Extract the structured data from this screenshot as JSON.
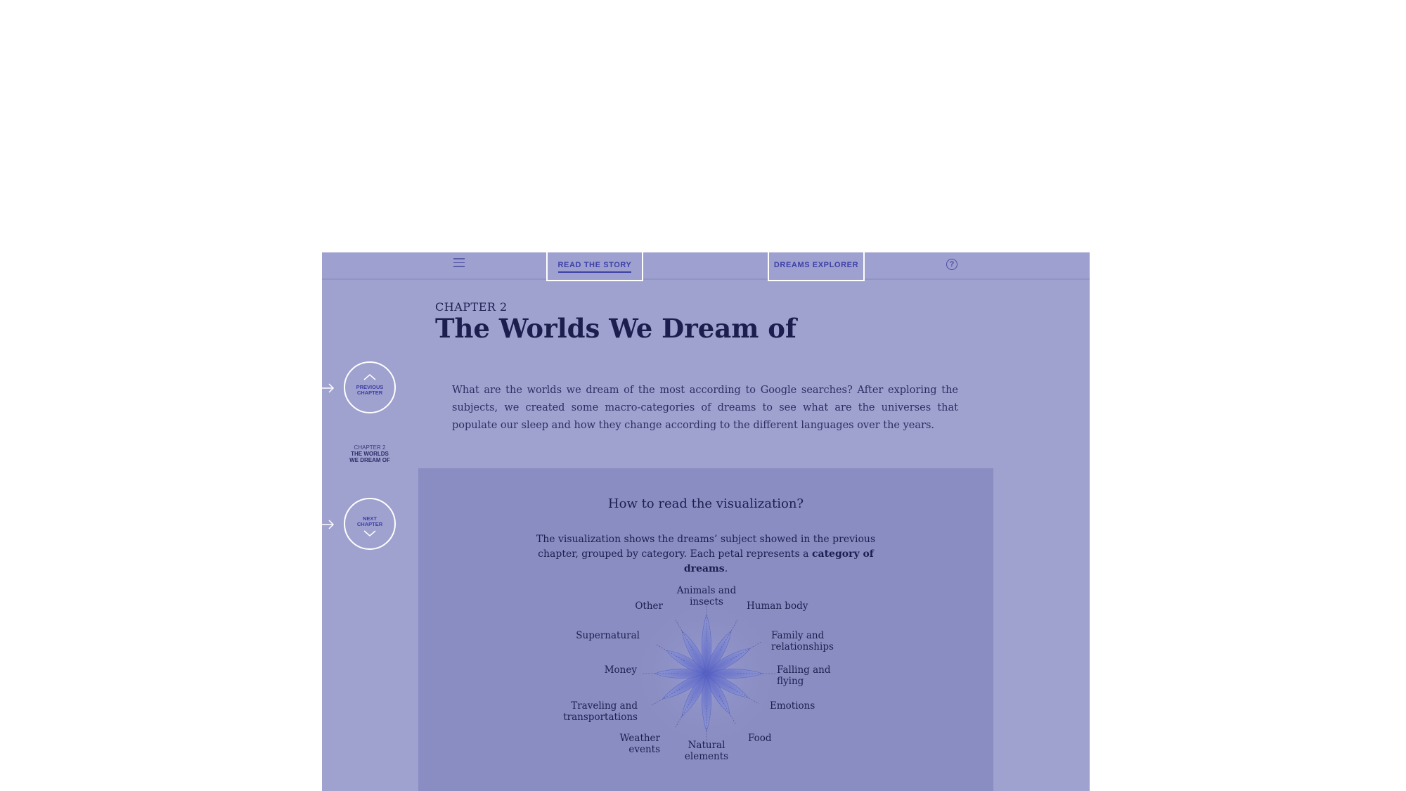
{
  "nav": {
    "menu_icon": "hamburger-menu-icon",
    "tab_story": "READ THE STORY",
    "tab_explorer": "DREAMS EXPLORER",
    "help_glyph": "?"
  },
  "chapter": {
    "label": "CHAPTER 2",
    "title": "The Worlds We Dream of",
    "intro": "What are the worlds we dream of the most according to Google searches? After exploring the subjects, we created some macro-categories of dreams to see what are the universes that populate our sleep and how they change according to the different languages over the years."
  },
  "side_nav": {
    "previous_line1": "PREVIOUS",
    "previous_line2": "CHAPTER",
    "current_line1": "CHAPTER 2",
    "current_line2": "THE WORLDS",
    "current_line3": "WE DREAM OF",
    "next_line1": "NEXT",
    "next_line2": "CHAPTER"
  },
  "panel": {
    "title": "How to read the visualization?",
    "desc_part1": "The visualization shows the dreams’ subject showed in the previous chapter, grouped by category. Each petal represents a ",
    "desc_bold": "category of dreams",
    "desc_part2": "."
  },
  "categories": [
    "Animals and insects",
    "Human body",
    "Family and relationships",
    "Falling and flying",
    "Emotions",
    "Food",
    "Natural elements",
    "Weather events",
    "Traveling and transportations",
    "Money",
    "Supernatural",
    "Other"
  ],
  "colors": {
    "background": "#9fa1cf",
    "panel": "#8a8dc2",
    "accent": "#3d41a6",
    "text": "#1c1f4e"
  }
}
